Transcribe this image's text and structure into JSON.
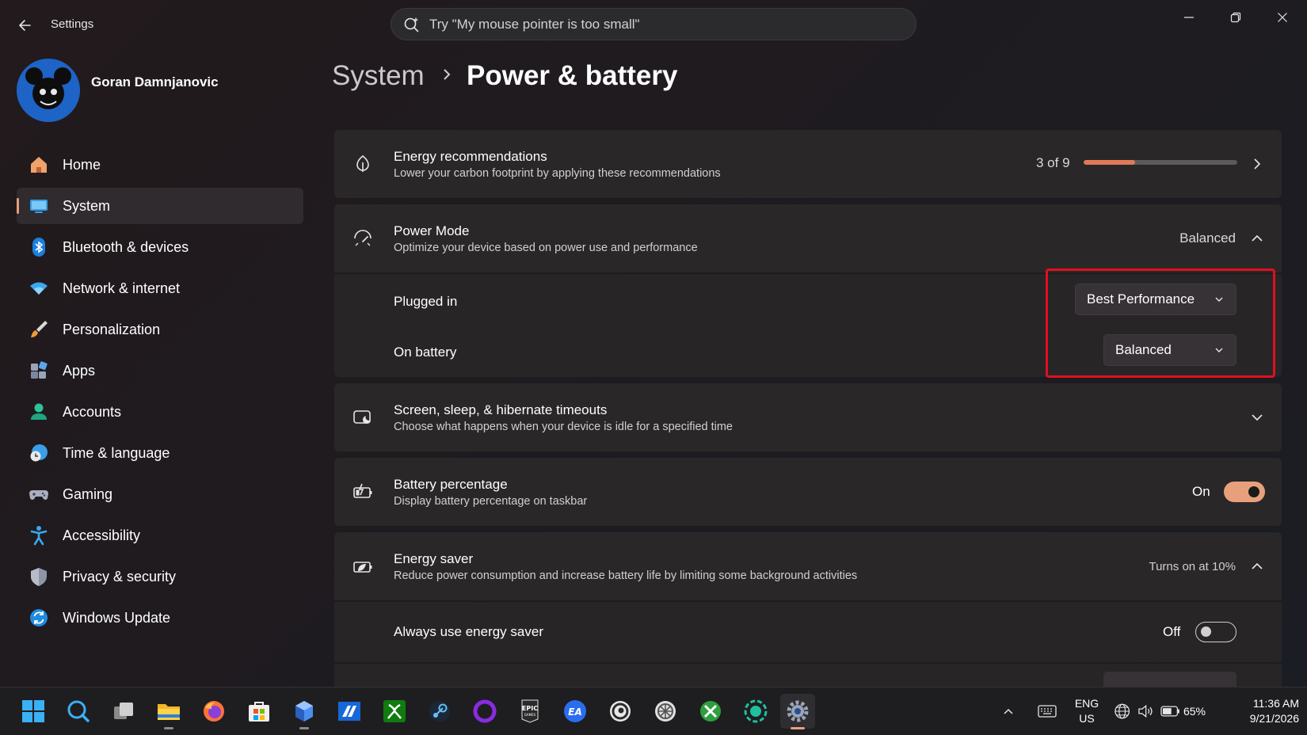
{
  "window": {
    "title": "Settings",
    "search_placeholder": "Try \"My mouse pointer is too small\""
  },
  "profile": {
    "name": "Goran Damnjanovic"
  },
  "sidebar": {
    "items": [
      {
        "label": "Home",
        "icon": "home-icon"
      },
      {
        "label": "System",
        "icon": "system-icon",
        "active": true
      },
      {
        "label": "Bluetooth & devices",
        "icon": "bluetooth-icon"
      },
      {
        "label": "Network & internet",
        "icon": "wifi-icon"
      },
      {
        "label": "Personalization",
        "icon": "brush-icon"
      },
      {
        "label": "Apps",
        "icon": "apps-icon"
      },
      {
        "label": "Accounts",
        "icon": "account-icon"
      },
      {
        "label": "Time & language",
        "icon": "globe-clock-icon"
      },
      {
        "label": "Gaming",
        "icon": "gamepad-icon"
      },
      {
        "label": "Accessibility",
        "icon": "accessibility-icon"
      },
      {
        "label": "Privacy & security",
        "icon": "shield-icon"
      },
      {
        "label": "Windows Update",
        "icon": "update-icon"
      }
    ]
  },
  "breadcrumb": {
    "parent": "System",
    "current": "Power & battery"
  },
  "energy_recommendations": {
    "title": "Energy recommendations",
    "description": "Lower your carbon footprint by applying these recommendations",
    "progress_label": "3 of 9",
    "progress_fraction": 0.333
  },
  "power_mode": {
    "title": "Power Mode",
    "description": "Optimize your device based on power use and performance",
    "value": "Balanced",
    "plugged_in_label": "Plugged in",
    "plugged_in_value": "Best Performance",
    "on_battery_label": "On battery",
    "on_battery_value": "Balanced"
  },
  "screen_sleep": {
    "title": "Screen, sleep, & hibernate timeouts",
    "description": "Choose what happens when your device is idle for a specified time"
  },
  "battery_percentage": {
    "title": "Battery percentage",
    "description": "Display battery percentage on taskbar",
    "state": "On"
  },
  "energy_saver": {
    "title": "Energy saver",
    "description": "Reduce power consumption and increase battery life by limiting some background activities",
    "status": "Turns on at 10%",
    "always_label": "Always use energy saver",
    "always_state": "Off"
  },
  "taskbar": {
    "apps": [
      "start",
      "search",
      "task-view",
      "file-explorer",
      "firefox",
      "microsoft-store",
      "app-7",
      "app-8",
      "xbox",
      "steam",
      "app-11",
      "epic-games",
      "ea",
      "ubisoft",
      "app-15",
      "app-16",
      "app-17",
      "settings"
    ],
    "language_top": "ENG",
    "language_bottom": "US",
    "battery": "65%",
    "time": "11:36 AM",
    "date": "9/21/2026"
  },
  "colors": {
    "accent": "#e6a07a",
    "progress": "#e07a57",
    "highlight": "#e0101e"
  }
}
